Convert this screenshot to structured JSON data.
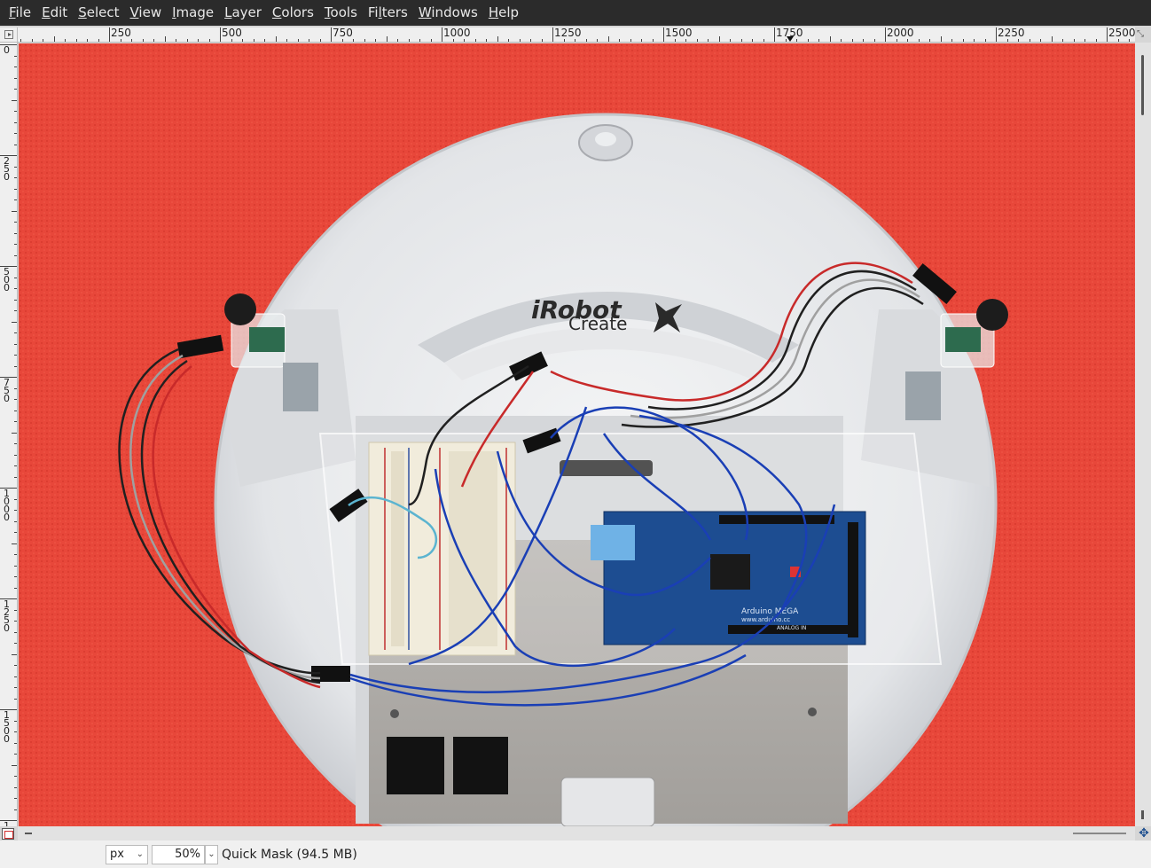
{
  "menubar": {
    "items": [
      {
        "label": "File",
        "mnemonic": "F",
        "rest": "ile"
      },
      {
        "label": "Edit",
        "mnemonic": "E",
        "rest": "dit"
      },
      {
        "label": "Select",
        "mnemonic": "S",
        "rest": "elect"
      },
      {
        "label": "View",
        "mnemonic": "V",
        "rest": "iew"
      },
      {
        "label": "Image",
        "mnemonic": "I",
        "rest": "mage"
      },
      {
        "label": "Layer",
        "mnemonic": "L",
        "rest": "ayer"
      },
      {
        "label": "Colors",
        "mnemonic": "C",
        "rest": "olors"
      },
      {
        "label": "Tools",
        "mnemonic": "T",
        "rest": "ools"
      },
      {
        "label": "Filters",
        "mnemonic": "F",
        "rest": "ilters",
        "pre": "Fi",
        "post": "ters",
        "mid": "l"
      },
      {
        "label": "Windows",
        "mnemonic": "W",
        "rest": "indows"
      },
      {
        "label": "Help",
        "mnemonic": "H",
        "rest": "elp"
      }
    ]
  },
  "rulers": {
    "horizontal_labels": [
      "250",
      "500",
      "750",
      "1000",
      "1250",
      "1500",
      "1750",
      "2000",
      "2250",
      "2500"
    ],
    "vertical_labels": [
      "0",
      "250",
      "500",
      "750",
      "1000",
      "1250",
      "1500",
      "1"
    ]
  },
  "canvas": {
    "image_description_labels": {
      "brand": "iRobot",
      "model": "Create",
      "board": "Arduino MEGA",
      "board_url": "www.arduino.cc",
      "analog": "ANALOG IN"
    },
    "background_color": "#e8473a"
  },
  "statusbar": {
    "unit": "px",
    "zoom": "50%",
    "status": "Quick Mask (94.5 MB)"
  }
}
